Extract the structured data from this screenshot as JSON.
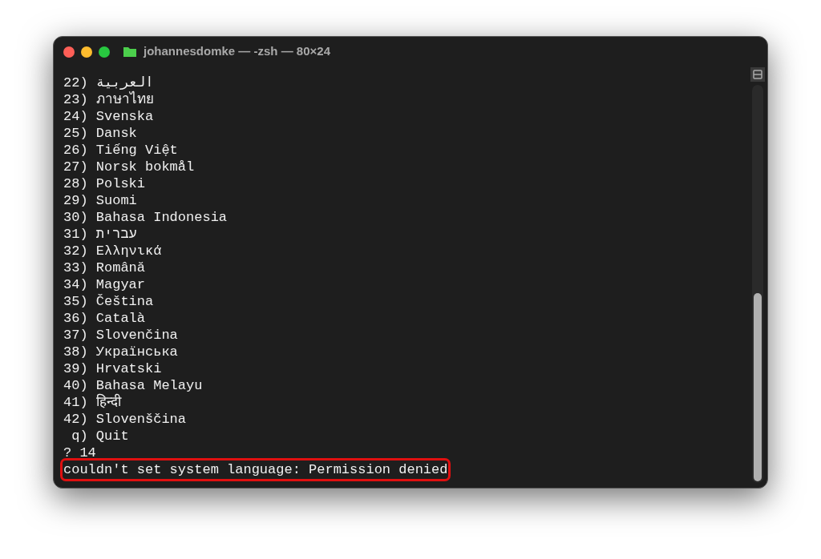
{
  "window": {
    "title": "johannesdomke — -zsh — 80×24"
  },
  "lines": [
    "22) العربية",
    "23) ภาษาไทย",
    "24) Svenska",
    "25) Dansk",
    "26) Tiếng Việt",
    "27) Norsk bokmål",
    "28) Polski",
    "29) Suomi",
    "30) Bahasa Indonesia",
    "31) עברית",
    "32) Ελληνικά",
    "33) Română",
    "34) Magyar",
    "35) Čeština",
    "36) Català",
    "37) Slovenčina",
    "38) Українська",
    "39) Hrvatski",
    "40) Bahasa Melayu",
    "41) हिन्दी",
    "42) Slovenščina",
    " q) Quit",
    "? 14"
  ],
  "error": {
    "text": "couldn't set system language: Permission denied",
    "highlighted": true
  }
}
